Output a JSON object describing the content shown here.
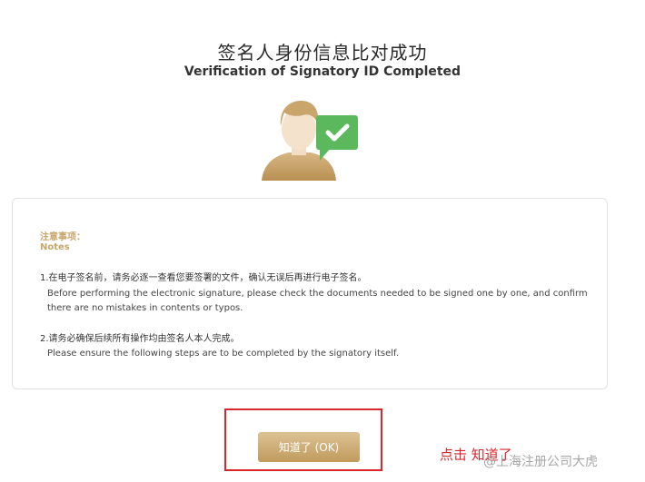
{
  "header": {
    "title_cn": "签名人身份信息比对成功",
    "title_en": "Verification of Signatory ID Completed"
  },
  "illustration": {
    "person_icon": "user-avatar-icon",
    "badge_icon": "check-speech-bubble-icon",
    "colors": {
      "person_gold": "#c9a46b",
      "badge_green": "#5cb85c"
    }
  },
  "notes": {
    "label_cn": "注意事项：",
    "label_en": "Notes",
    "items": [
      {
        "cn": "1.在电子签名前，请务必逐一查看您要签署的文件，确认无误后再进行电子签名。",
        "en": "Before performing the electronic signature, please check the documents needed to be signed one by one, and confirm there are no mistakes in contents or typos."
      },
      {
        "cn": "2.请务必确保后续所有操作均由签名人本人完成。",
        "en": "Please ensure the following steps are to be completed by the signatory itself."
      }
    ]
  },
  "actions": {
    "ok_label": "知道了 (OK)",
    "hint": "点击 知道了"
  },
  "watermark": {
    "text": "@上海注册公司大虎"
  },
  "theme": {
    "accent": "#c8a56a",
    "highlight_red": "#d9262c"
  }
}
